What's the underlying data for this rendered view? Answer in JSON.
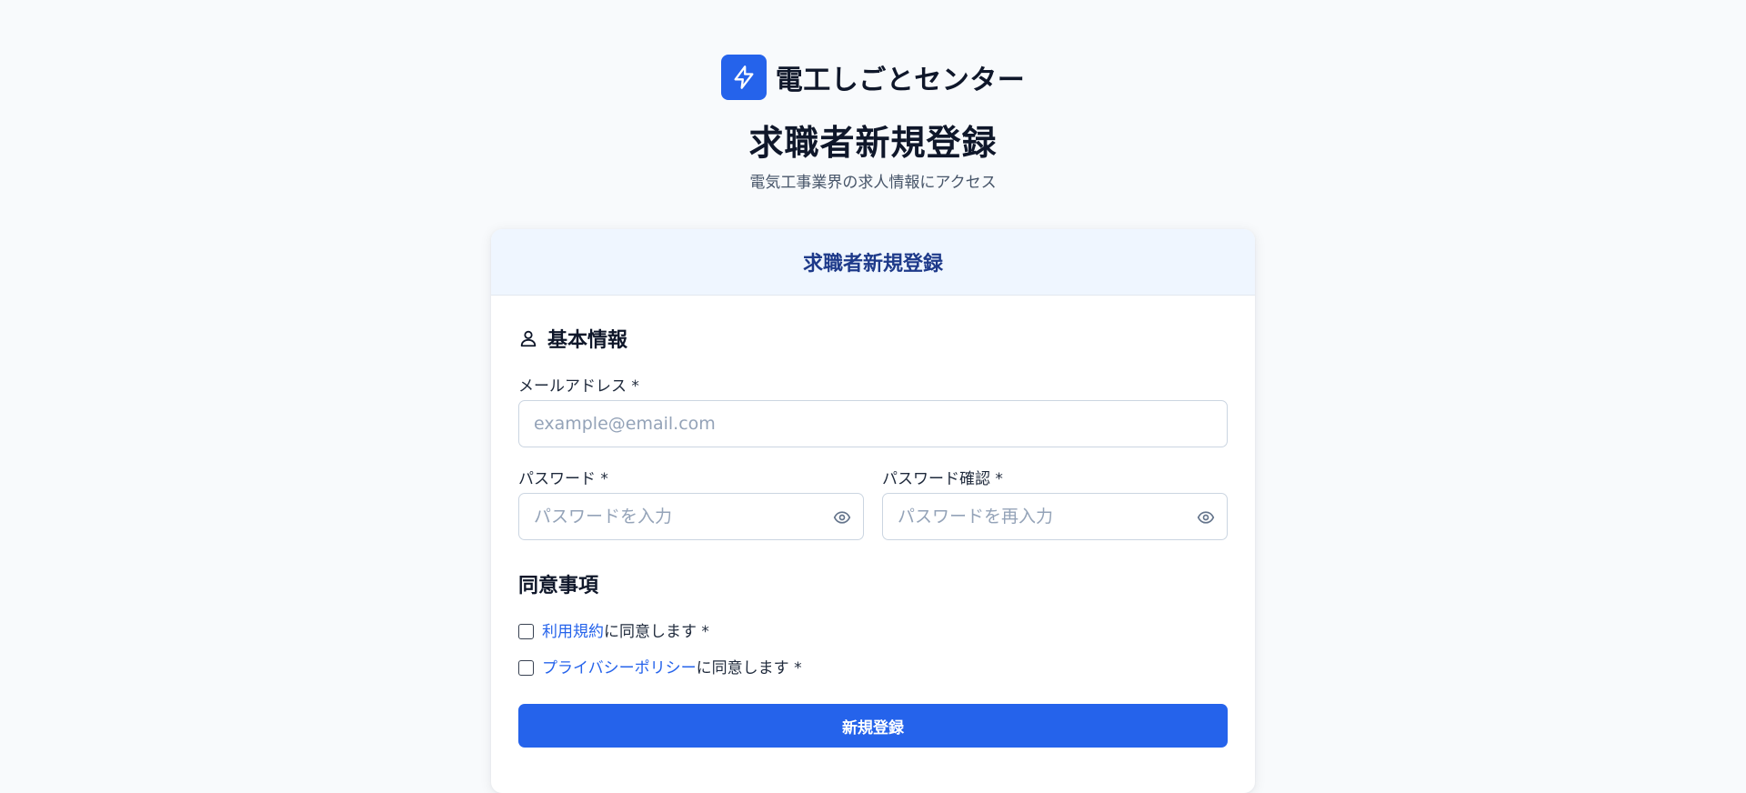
{
  "brand": {
    "name": "電工しごとセンター",
    "logo_icon": "lightning-bolt-icon",
    "logo_color": "#2563eb"
  },
  "page": {
    "title": "求職者新規登録",
    "subtitle": "電気工事業界の求人情報にアクセス"
  },
  "card": {
    "header_title": "求職者新規登録",
    "basic_info": {
      "heading": "基本情報",
      "icon": "user-icon",
      "email": {
        "label": "メールアドレス *",
        "placeholder": "example@email.com",
        "value": ""
      },
      "password": {
        "label": "パスワード *",
        "placeholder": "パスワードを入力",
        "value": "",
        "toggle_icon": "eye-icon"
      },
      "password_confirm": {
        "label": "パスワード確認 *",
        "placeholder": "パスワードを再入力",
        "value": "",
        "toggle_icon": "eye-icon"
      }
    },
    "agreements": {
      "heading": "同意事項",
      "terms": {
        "link_text": "利用規約",
        "suffix": "に同意します *",
        "checked": false
      },
      "privacy": {
        "link_text": "プライバシーポリシー",
        "suffix": "に同意します *",
        "checked": false
      }
    },
    "submit_label": "新規登録"
  },
  "colors": {
    "accent": "#2563eb",
    "header_bg": "#eff6ff",
    "header_text": "#1e3a8a",
    "background": "#f8fafc"
  }
}
